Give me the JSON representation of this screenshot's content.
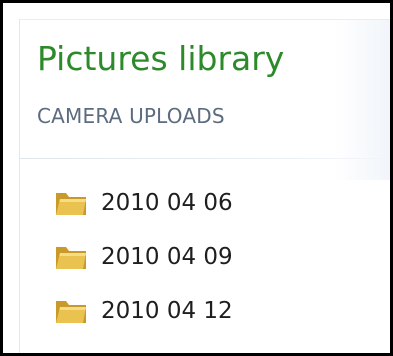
{
  "library": {
    "title": "Pictures library",
    "subtitle": "CAMERA UPLOADS"
  },
  "folders": [
    {
      "name": "2010 04 06",
      "icon": "folder-icon"
    },
    {
      "name": "2010 04 09",
      "icon": "folder-icon"
    },
    {
      "name": "2010 04 12",
      "icon": "folder-icon"
    }
  ],
  "colors": {
    "title": "#2d8a2b",
    "subtitle": "#5c6b80",
    "folder_body": "#e9c24f",
    "folder_shadow": "#c99a2a"
  }
}
